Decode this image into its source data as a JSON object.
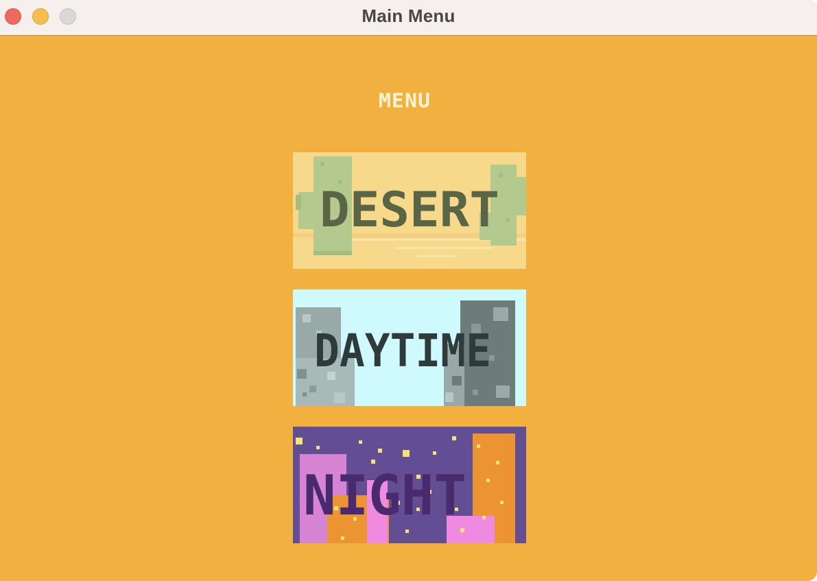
{
  "window": {
    "title": "Main Menu"
  },
  "menu": {
    "heading": "MENU",
    "buttons": [
      {
        "label": "DESERT"
      },
      {
        "label": "DAYTIME"
      },
      {
        "label": "NIGHT"
      }
    ]
  },
  "colors": {
    "background": "#F2B03E",
    "titlebar": "#F5EFEE",
    "desert_sky": "#F7D98C",
    "cactus": "#B4C98E",
    "day_sky": "#CFFAFD",
    "building_gray": "#98A9A8",
    "night_sky": "#634E94",
    "night_orange": "#EC9334",
    "night_pink": "#D884D4"
  }
}
